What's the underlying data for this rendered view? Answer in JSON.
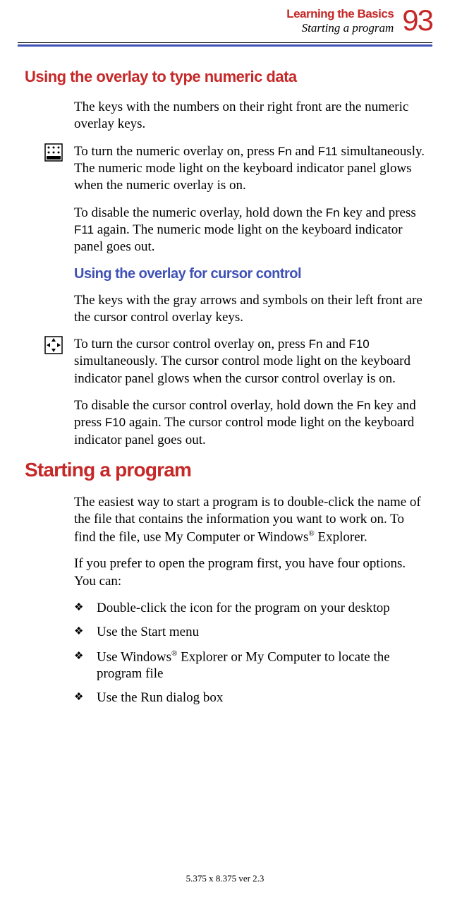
{
  "header": {
    "chapter": "Learning the Basics",
    "section": "Starting a program",
    "page": "93"
  },
  "h1": "Using the overlay to type numeric data",
  "p1": "The keys with the numbers on their right front are the numeric overlay keys.",
  "p2a": "To turn the numeric overlay on, press ",
  "p2b": "Fn",
  "p2c": " and ",
  "p2d": "F11",
  "p2e": " simultaneously. The numeric mode light on the keyboard indicator panel glows when the numeric overlay is on.",
  "p3a": "To disable the numeric overlay, hold down the ",
  "p3b": "Fn",
  "p3c": " key and press ",
  "p3d": "F11",
  "p3e": " again. The numeric mode light on the keyboard indicator panel goes out.",
  "h2": "Using the overlay for cursor control",
  "p4": "The keys with the gray arrows and symbols on their left front are the cursor control overlay keys.",
  "p5a": "To turn the cursor control overlay on, press ",
  "p5b": "Fn",
  "p5c": " and ",
  "p5d": "F10",
  "p5e": " simultaneously. The cursor control mode light on the keyboard indicator panel glows when the cursor control overlay is on.",
  "p6a": "To disable the cursor control overlay, hold down the ",
  "p6b": "Fn",
  "p6c": " key and press ",
  "p6d": "F10",
  "p6e": " again. The cursor control mode light on the keyboard indicator panel goes out.",
  "h3": "Starting a program",
  "p7a": "The easiest way to start a program is to double-click the name of the file that contains the information you want to work on. To find the file, use My Computer or Windows",
  "p7b": "®",
  "p7c": " Explorer.",
  "p8": "If you prefer to open the program first, you have four options. You can:",
  "bullet": "❖",
  "li1": "Double-click the icon for the program on your desktop",
  "li2": "Use the Start menu",
  "li3a": "Use Windows",
  "li3b": "®",
  "li3c": " Explorer or My Computer to locate the program file",
  "li4": "Use the Run dialog box",
  "footer": "5.375 x 8.375 ver 2.3"
}
